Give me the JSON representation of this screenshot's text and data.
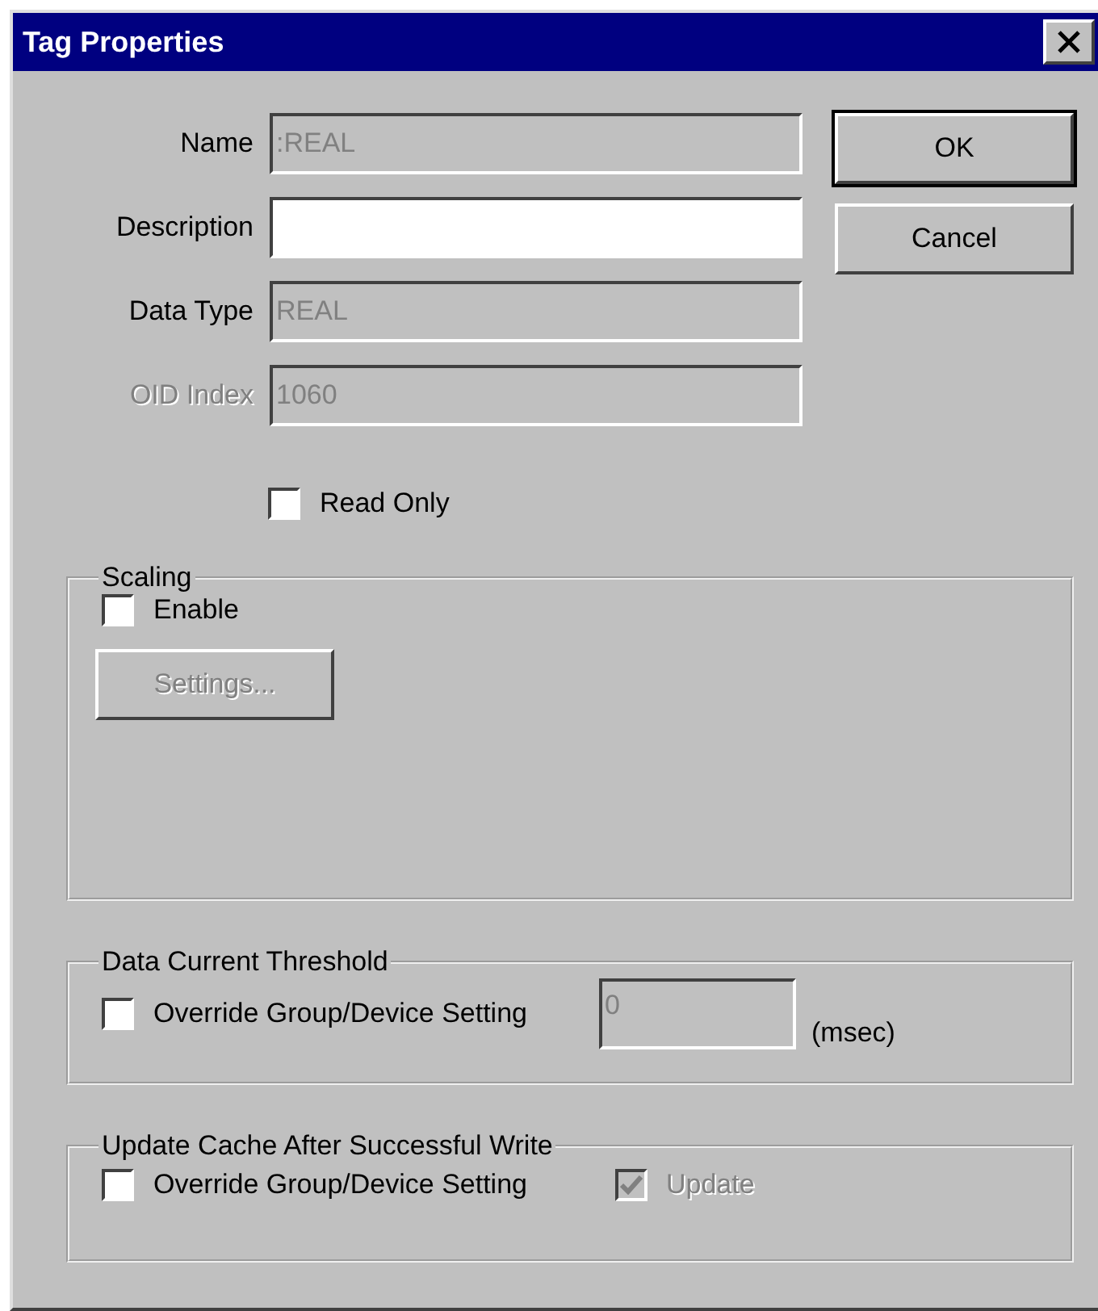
{
  "window": {
    "title": "Tag Properties"
  },
  "fields": [
    {
      "label": "Name",
      "value": ":REAL",
      "disabled": true,
      "label_disabled": false
    },
    {
      "label": "Description",
      "disabled": false,
      "label_disabled": false
    },
    {
      "label": "Data Type",
      "value": "REAL",
      "disabled": true,
      "label_disabled": false
    },
    {
      "label": "OID Index",
      "value": "1060",
      "disabled": true,
      "label_disabled": true
    }
  ],
  "buttons": [
    {
      "label": "OK",
      "default": true
    },
    {
      "label": "Cancel",
      "default": false
    }
  ],
  "read_only": {
    "label": "Read Only",
    "checked": false
  },
  "scaling": {
    "title": "Scaling",
    "enable": {
      "label": "Enable",
      "checked": false
    },
    "settings_button": {
      "label": "Settings...",
      "disabled": true
    }
  },
  "data_current_threshold": {
    "title": "Data Current Threshold",
    "override": {
      "label": "Override Group/Device Setting",
      "checked": false
    },
    "value_field": {
      "value": "0",
      "disabled": true
    },
    "unit": "(msec)"
  },
  "update_cache": {
    "title": "Update Cache After Successful Write",
    "override": {
      "label": "Override Group/Device Setting",
      "checked": false
    },
    "update": {
      "label": "Update",
      "checked": true,
      "disabled": true
    }
  }
}
